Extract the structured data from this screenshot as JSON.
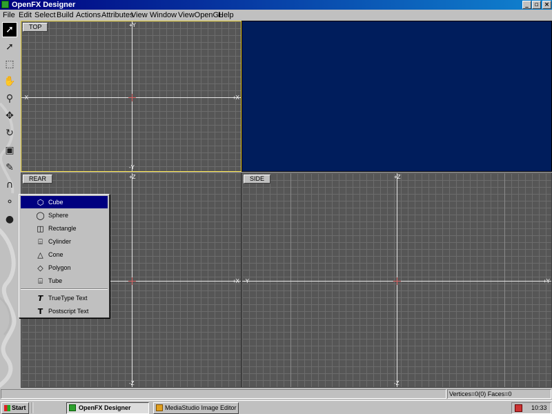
{
  "window": {
    "title": "OpenFX Designer",
    "minimize": "_",
    "maximize": "▫",
    "close": "×"
  },
  "menu": [
    "File",
    "Edit",
    "Select",
    "Build",
    "Actions",
    "Attributes",
    "View",
    "Window",
    "ViewOpenGL",
    "Help"
  ],
  "toolbar": {
    "tools": [
      "select-arrow-icon",
      "pointer-icon",
      "box-select-icon",
      "hand-pan-icon",
      "zoom-icon",
      "move-icon",
      "rotate-icon",
      "frame-icon",
      "pen-icon",
      "magnet-icon",
      "primitives-icon",
      "sphere-ball-icon"
    ]
  },
  "viewports": {
    "top": {
      "label": "TOP",
      "x_neg": "-X",
      "x_pos": "+X",
      "y_pos": "+Y",
      "y_neg": "-Y"
    },
    "rear": {
      "label": "REAR",
      "z_pos": "+Z",
      "z_neg": "-Z",
      "x_pos": "+X"
    },
    "side": {
      "label": "SIDE",
      "z_pos": "+Z",
      "z_neg": "-Z",
      "y_neg": "-Y",
      "y_pos": "+Y"
    },
    "camera": {
      "background": "#001d5c"
    }
  },
  "popup_menu": {
    "items": [
      {
        "label": "Cube",
        "icon": "cube-icon",
        "selected": true
      },
      {
        "label": "Sphere",
        "icon": "sphere-icon"
      },
      {
        "label": "Rectangle",
        "icon": "rectangle-icon"
      },
      {
        "label": "Cylinder",
        "icon": "cylinder-icon"
      },
      {
        "label": "Cone",
        "icon": "cone-icon"
      },
      {
        "label": "Polygon",
        "icon": "polygon-icon"
      },
      {
        "label": "Tube",
        "icon": "tube-icon"
      }
    ],
    "text_items": [
      {
        "label": "TrueType Text",
        "icon": "truetype-icon"
      },
      {
        "label": "Postscript Text",
        "icon": "postscript-icon"
      }
    ]
  },
  "status": {
    "text": "Vertices=0(0) Faces=0"
  },
  "taskbar": {
    "start": "Start",
    "tasks": [
      {
        "label": "OpenFX Designer",
        "active": true
      },
      {
        "label": "MediaStudio Image Editor",
        "active": false
      }
    ],
    "clock": "10:33"
  },
  "colors": {
    "title_active": "#000080",
    "selection": "#000080",
    "viewport_bg": "#565656",
    "active_border": "#e8d23a"
  }
}
